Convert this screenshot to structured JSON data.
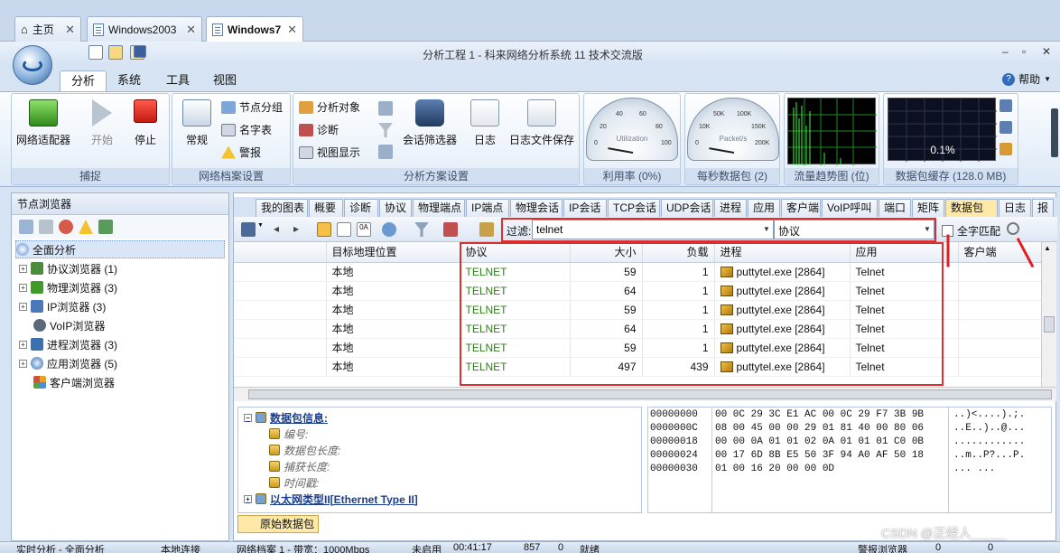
{
  "doc_tabs": [
    {
      "label": "主页",
      "active": false
    },
    {
      "label": "Windows2003",
      "active": false
    },
    {
      "label": "Windows7",
      "active": true
    }
  ],
  "app_title": "分析工程 1 - 科来网络分析系统 11 技术交流版",
  "ribbon_tabs": [
    "分析",
    "系统",
    "工具",
    "视图"
  ],
  "help_label": "帮助",
  "ribbon": {
    "capture": {
      "label": "捕捉",
      "buttons": [
        "网络适配器",
        "开始",
        "停止"
      ]
    },
    "profile": {
      "label": "网络档案设置",
      "big": "常规",
      "small": [
        "节点分组",
        "名字表",
        "警报"
      ]
    },
    "scheme": {
      "label": "分析方案设置",
      "small": [
        "分析对象",
        "诊断",
        "视图显示"
      ],
      "big": [
        "会话筛选器",
        "日志",
        "日志文件保存"
      ]
    },
    "gauges": [
      {
        "label": "利用率 (0%)",
        "name": "Utilization",
        "ticks": [
          "0",
          "20",
          "40",
          "60",
          "80",
          "100"
        ]
      },
      {
        "label": "每秒数据包 (2)",
        "name": "Packet/s",
        "ticks": [
          "0",
          "10K",
          "50K",
          "100K",
          "150K",
          "200K"
        ]
      }
    ],
    "trend_label": "流量趋势图 (位)",
    "buffer_label": "数据包缓存 (128.0 MB)",
    "buffer_value": "0.1%"
  },
  "left_panel": {
    "title": "节点浏览器",
    "items": [
      {
        "label": "全面分析",
        "expand": "",
        "selected": true
      },
      {
        "label": "协议浏览器 (1)",
        "expand": "+"
      },
      {
        "label": "物理浏览器 (3)",
        "expand": "+"
      },
      {
        "label": "IP浏览器 (3)",
        "expand": "+"
      },
      {
        "label": "VoIP浏览器",
        "expand": ""
      },
      {
        "label": "进程浏览器 (3)",
        "expand": "+"
      },
      {
        "label": "应用浏览器 (5)",
        "expand": "+"
      },
      {
        "label": "客户端浏览器",
        "expand": ""
      }
    ]
  },
  "view_tabs": [
    "我的图表",
    "概要",
    "诊断",
    "协议",
    "物理端点",
    "IP端点",
    "物理会话",
    "IP会话",
    "TCP会话",
    "UDP会话",
    "进程",
    "应用",
    "客户端",
    "VoIP呼叫",
    "端口",
    "矩阵",
    "数据包",
    "日志",
    "报"
  ],
  "active_view_tab": "数据包",
  "filter": {
    "label": "过滤:",
    "value": "telnet",
    "protocol_placeholder": "协议",
    "full_match_label": "全字匹配"
  },
  "packet_table": {
    "columns": [
      "",
      "目标地理位置",
      "协议",
      "大小",
      "负载",
      "进程",
      "应用",
      "客户端"
    ],
    "rows": [
      [
        "",
        "本地",
        "TELNET",
        "59",
        "1",
        "puttytel.exe [2864]",
        "Telnet",
        ""
      ],
      [
        "",
        "本地",
        "TELNET",
        "64",
        "1",
        "puttytel.exe [2864]",
        "Telnet",
        ""
      ],
      [
        "",
        "本地",
        "TELNET",
        "59",
        "1",
        "puttytel.exe [2864]",
        "Telnet",
        ""
      ],
      [
        "",
        "本地",
        "TELNET",
        "64",
        "1",
        "puttytel.exe [2864]",
        "Telnet",
        ""
      ],
      [
        "",
        "本地",
        "TELNET",
        "59",
        "1",
        "puttytel.exe [2864]",
        "Telnet",
        ""
      ],
      [
        "",
        "本地",
        "TELNET",
        "497",
        "439",
        "puttytel.exe [2864]",
        "Telnet",
        ""
      ]
    ]
  },
  "detail_tree": {
    "title": "数据包信息:",
    "fields": [
      "编号:",
      "数据包长度:",
      "捕获长度:",
      "时间戳:"
    ],
    "next": "以太网类型II[Ethernet Type II]"
  },
  "hex_dump": [
    {
      "offset": "00000000",
      "bytes": "00 0C 29 3C E1 AC 00 0C 29 F7 3B 9B",
      "ascii": "..)<....).;."
    },
    {
      "offset": "0000000C",
      "bytes": "08 00 45 00 00 29 01 81 40 00 80 06",
      "ascii": "..E..)..@..."
    },
    {
      "offset": "00000018",
      "bytes": "00 00 0A 01 01 02 0A 01 01 01 C0 0B",
      "ascii": "............"
    },
    {
      "offset": "00000024",
      "bytes": "00 17 6D 8B E5 50 3F 94 A0 AF 50 18",
      "ascii": "..m..P?...P."
    },
    {
      "offset": "00000030",
      "bytes": "01 00 16 20 00 00 0D",
      "ascii": "... ..."
    }
  ],
  "raw_tab_label": "原始数据包",
  "status_bar": [
    "实时分析 - 全面分析",
    "本地连接",
    "网络档案 1 - 带宽：1000Mbps",
    "未启用",
    "00:41:17",
    "857",
    "0",
    "就绪",
    "警报浏览器",
    "0",
    "0"
  ],
  "watermark": "CSDN @正经人_____",
  "colors": {
    "accent_red": "#d83030",
    "protocol_green": "#2e7d1b",
    "active_tab": "#ffe9a8"
  }
}
